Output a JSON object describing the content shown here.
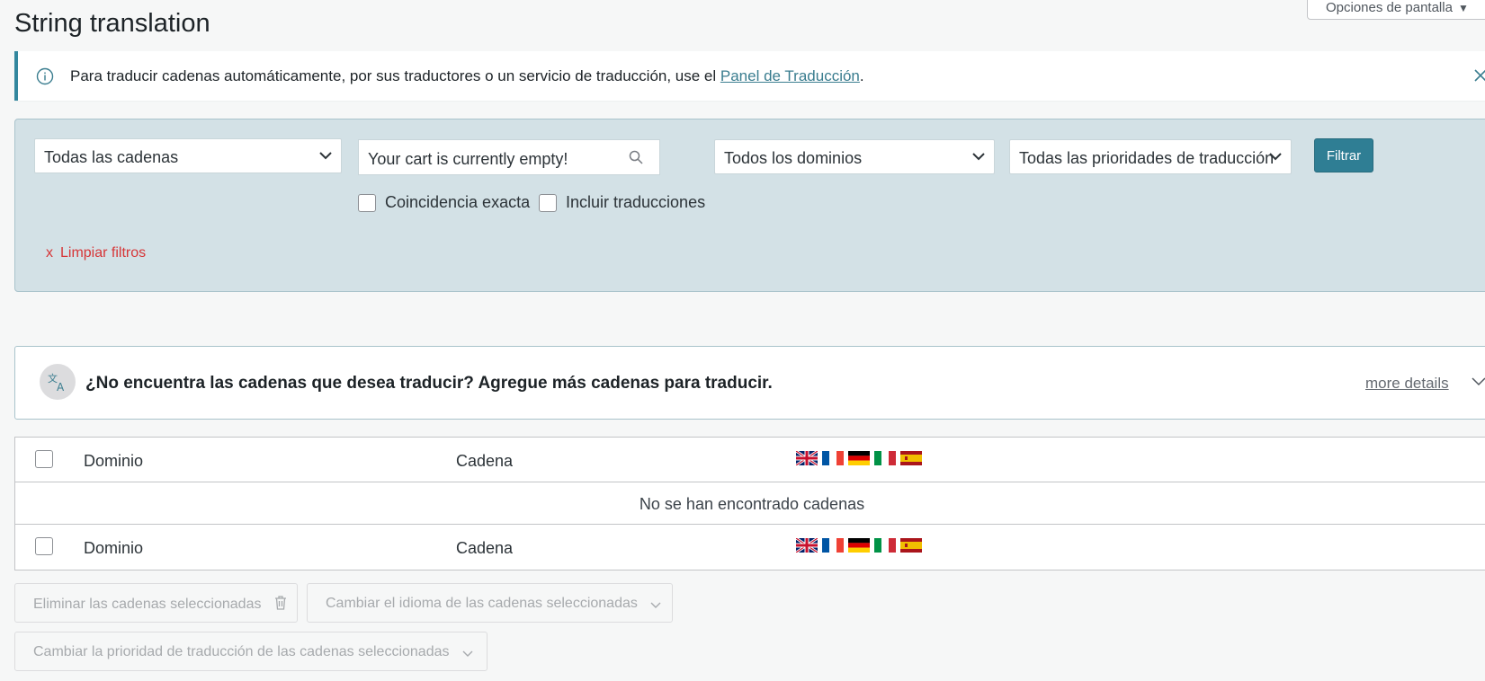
{
  "header": {
    "title": "String translation",
    "screen_options": "Opciones de pantalla"
  },
  "notice": {
    "text": "Para traducir cadenas automáticamente, por sus traductores o un servicio de traducción, use el ",
    "link": "Panel de Traducción",
    "suffix": "."
  },
  "filters": {
    "strings_select": "Todas las cadenas",
    "search_value": "Your cart is currently empty!",
    "domains_select": "Todos los dominios",
    "priority_select": "Todas las prioridades de traducción",
    "filter_button": "Filtrar",
    "exact_match": "Coincidencia exacta",
    "include_translations": "Incluir traducciones",
    "clear_x": "x",
    "clear_filters": "Limpiar filtros"
  },
  "more_strings": {
    "title": "¿No encuentra las cadenas que desea traducir? Agregue más cadenas para traducir.",
    "details_link": "more details"
  },
  "table": {
    "col_domain": "Dominio",
    "col_string": "Cadena",
    "empty_message": "No se han encontrado cadenas",
    "languages": [
      "en",
      "fr",
      "de",
      "it",
      "es"
    ]
  },
  "bulk_actions": {
    "delete": "Eliminar las cadenas seleccionadas",
    "change_language": "Cambiar el idioma de las cadenas seleccionadas",
    "change_priority": "Cambiar la prioridad de traducción de las cadenas seleccionadas"
  },
  "colors": {
    "accent": "#2f7e94",
    "filter_panel": "#d3e1e6",
    "danger": "#d63638"
  },
  "icons": [
    "info-icon",
    "close-icon",
    "search-icon",
    "chevron-down-icon",
    "translate-icon",
    "trash-icon"
  ]
}
